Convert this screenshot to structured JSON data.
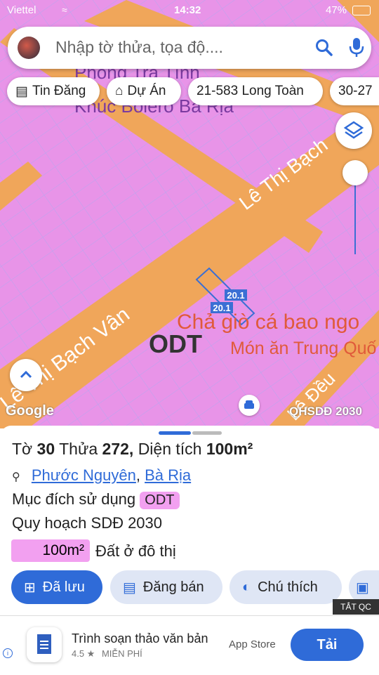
{
  "status_bar": {
    "carrier": "Viettel",
    "time": "14:32",
    "battery": "47%"
  },
  "search": {
    "placeholder": "Nhập tờ thửa, tọa độ...."
  },
  "chips": [
    {
      "label": "Tin Đăng",
      "icon": "newspaper-icon"
    },
    {
      "label": "Dự Án",
      "icon": "building-icon"
    },
    {
      "label": "21-583 Long Toàn",
      "icon": ""
    },
    {
      "label": "30-27",
      "icon": ""
    }
  ],
  "map": {
    "labels": {
      "poi_1_line1": "Phòng Trà Tình",
      "poi_1_line2": "Khúc Bolero Bà Rịa",
      "street_1": "Lê Thị Bạch",
      "street_2": "Lê Thị Bạch Vân",
      "street_3": "Lê Đều",
      "zone": "ODT",
      "restaurant_name": "Chả giò cá bao ngo",
      "restaurant_type": "Món ăn Trung Quố",
      "dim_1": "20.1",
      "dim_2": "20.1"
    },
    "google_logo": "Google",
    "layer_name": "QHSDĐ 2030",
    "colors": {
      "land": "#e894e8",
      "road": "#f0a65a",
      "parcel_line": "#5b8fd8",
      "restaurant": "#e05a3a"
    }
  },
  "parcel": {
    "sheet_label": "Tờ",
    "sheet_no": "30",
    "parcel_label": "Thửa",
    "parcel_no": "272,",
    "area_label": "Diện tích",
    "area": "100m²",
    "ward": "Phước Nguyên",
    "city": "Bà Rịa",
    "purpose_label": "Mục đích sử dụng",
    "purpose": "ODT",
    "plan_label": "Quy hoạch SDĐ 2030",
    "plan_area": "100m²",
    "plan_use": "Đất ở đô thị"
  },
  "actions": {
    "saved": "Đã lưu",
    "post_sale": "Đăng bán",
    "legend": "Chú thích"
  },
  "ad": {
    "badge": "TẮT QC",
    "app_title": "Trình soạn thảo văn bản",
    "rating": "4.5 ★",
    "price": "MIỄN PHÍ",
    "store": "App Store",
    "install": "Tải"
  }
}
